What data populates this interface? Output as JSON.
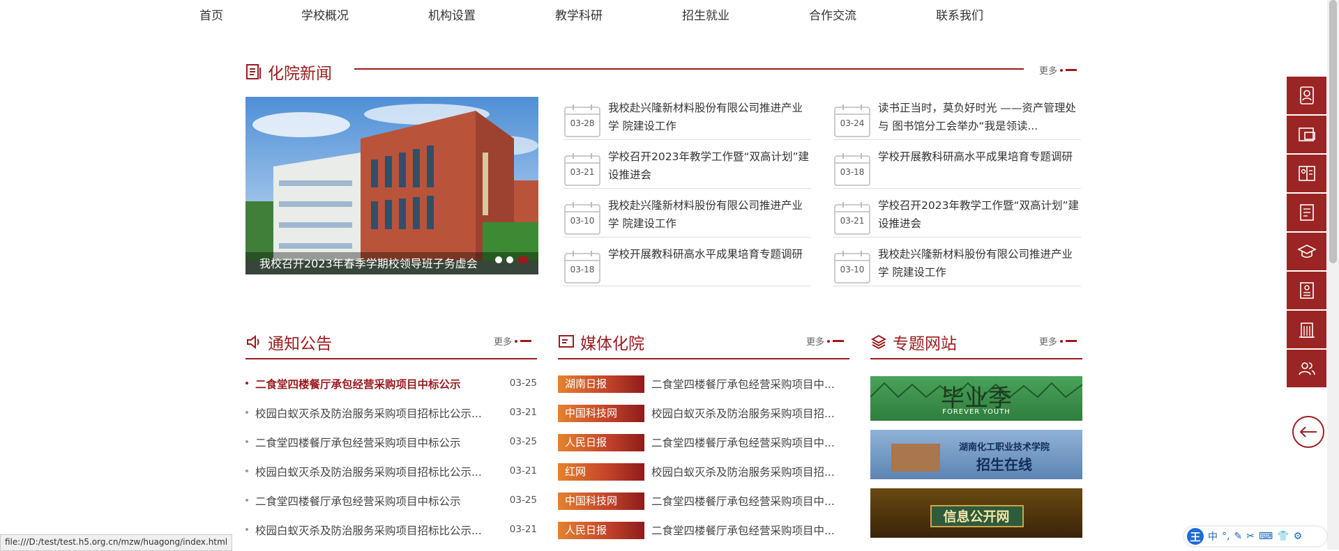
{
  "nav": {
    "items": [
      "首页",
      "学校概况",
      "机构设置",
      "教学科研",
      "招生就业",
      "合作交流",
      "联系我们"
    ]
  },
  "news": {
    "title": "化院新闻",
    "more": "更多",
    "photo_caption": "我校召开2023年春季学期校领导班子务虚会",
    "photo_dots": 3,
    "photo_active_dot": 3,
    "left": [
      {
        "date": "03-28",
        "title": "我校赴兴隆新材料股份有限公司推进产业学 院建设工作"
      },
      {
        "date": "03-21",
        "title": "学校召开2023年教学工作暨“双高计划”建 设推进会"
      },
      {
        "date": "03-10",
        "title": "我校赴兴隆新材料股份有限公司推进产业学 院建设工作"
      },
      {
        "date": "03-18",
        "title": "学校开展教科研高水平成果培育专题调研"
      }
    ],
    "right": [
      {
        "date": "03-24",
        "title": "读书正当时，莫负好时光 ——资产管理处与 图书馆分工会举办“我是领读..."
      },
      {
        "date": "03-18",
        "title": "学校开展教科研高水平成果培育专题调研"
      },
      {
        "date": "03-21",
        "title": "学校召开2023年教学工作暨“双高计划”建 设推进会"
      },
      {
        "date": "03-10",
        "title": "我校赴兴隆新材料股份有限公司推进产业学 院建设工作"
      }
    ]
  },
  "notices": {
    "title": "通知公告",
    "more": "更多",
    "items": [
      {
        "title": "二食堂四楼餐厅承包经营采购项目中标公示",
        "date": "03-25"
      },
      {
        "title": "校园白蚁灭杀及防治服务采购项目招标比公示...",
        "date": "03-21"
      },
      {
        "title": "二食堂四楼餐厅承包经营采购项目中标公示",
        "date": "03-25"
      },
      {
        "title": "校园白蚁灭杀及防治服务采购项目招标比公示...",
        "date": "03-21"
      },
      {
        "title": "二食堂四楼餐厅承包经营采购项目中标公示",
        "date": "03-25"
      },
      {
        "title": "校园白蚁灭杀及防治服务采购项目招标比公示...",
        "date": "03-21"
      }
    ]
  },
  "media": {
    "title": "媒体化院",
    "more": "更多",
    "items": [
      {
        "source": "湖南日报",
        "title": "二食堂四楼餐厅承包经营采购项目中..."
      },
      {
        "source": "中国科技网",
        "title": "校园白蚁灭杀及防治服务采购项目招..."
      },
      {
        "source": "人民日报",
        "title": "二食堂四楼餐厅承包经营采购项目中..."
      },
      {
        "source": "红网",
        "title": "校园白蚁灭杀及防治服务采购项目招..."
      },
      {
        "source": "中国科技网",
        "title": "二食堂四楼餐厅承包经营采购项目中..."
      },
      {
        "source": "人民日报",
        "title": "二食堂四楼餐厅承包经营采购项目中..."
      }
    ]
  },
  "topics": {
    "title": "专题网站",
    "more": "更多",
    "banners": [
      {
        "title": "毕业季",
        "subtitle": "FOREVER YOUTH"
      },
      {
        "title": "湖南化工职业技术学院",
        "subtitle": "招生在线"
      },
      {
        "title": "信息公开网"
      }
    ]
  },
  "toolbar": {
    "icons": [
      "user-card-icon",
      "message-icon",
      "id-card-icon",
      "document-icon",
      "graduation-cap-icon",
      "resume-icon",
      "building-icon",
      "people-icon"
    ]
  },
  "status_url": "file:///D:/test/test.h5.org.cn/mzw/huagong/index.html",
  "ime": {
    "label": "王",
    "items": [
      "中",
      "°,",
      "✎",
      "✂",
      "⌨",
      "👕",
      "⚙"
    ]
  },
  "colors": {
    "accent": "#9b1a1e",
    "toolbar": "#9b2424"
  }
}
